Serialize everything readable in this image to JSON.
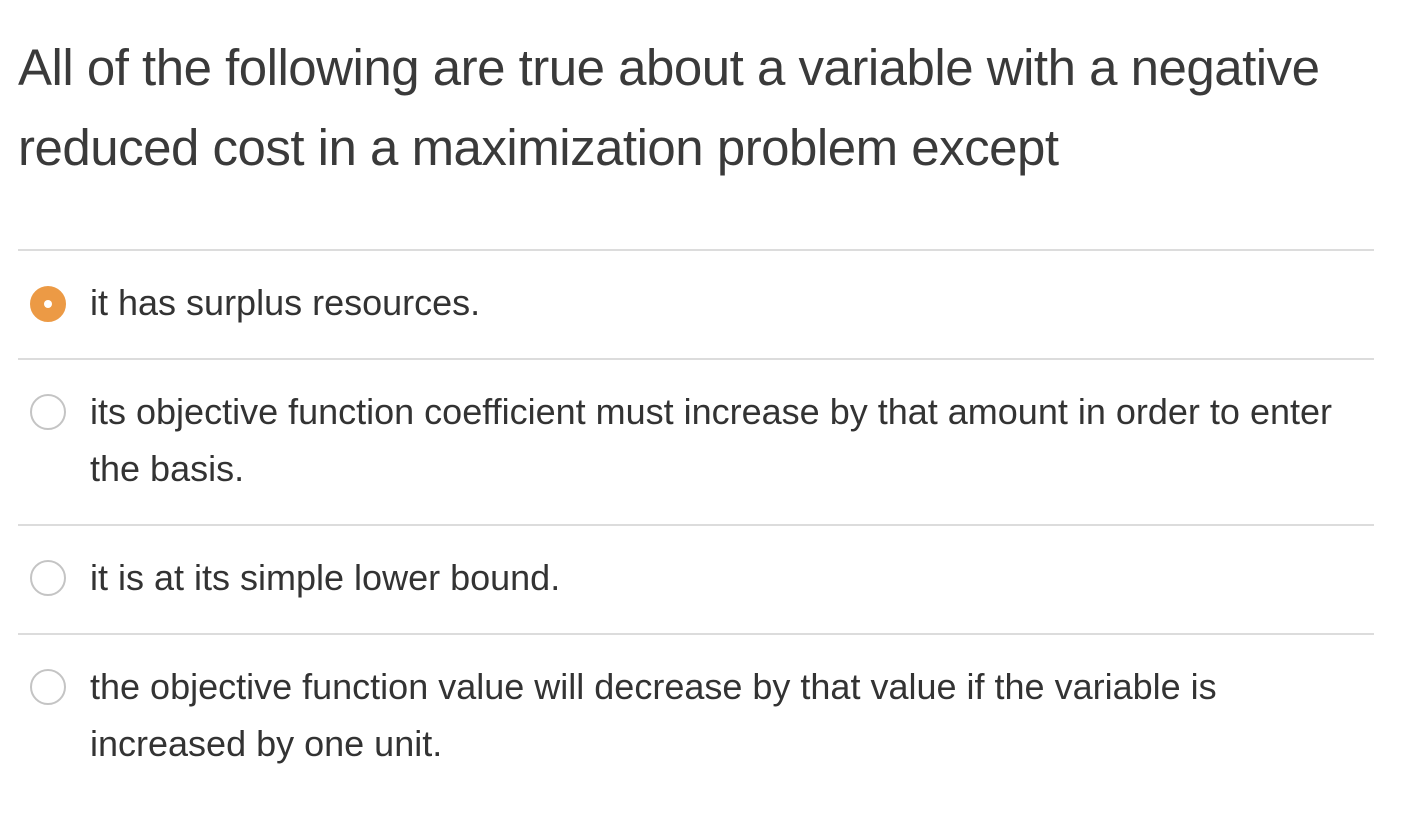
{
  "question": {
    "text": "All of the following are true about a variable with a negative reduced cost in a maximization problem except"
  },
  "options": [
    {
      "label": "it has surplus resources.",
      "selected": true
    },
    {
      "label": "its objective function coefficient must increase by that amount in order to enter the basis.",
      "selected": false
    },
    {
      "label": "it is at its simple lower bound.",
      "selected": false
    },
    {
      "label": "the objective function value will decrease by that value if the variable is increased by one unit.",
      "selected": false
    }
  ],
  "colors": {
    "accent": "#ec9a45",
    "divider": "#dcdcdc",
    "text": "#333333"
  }
}
